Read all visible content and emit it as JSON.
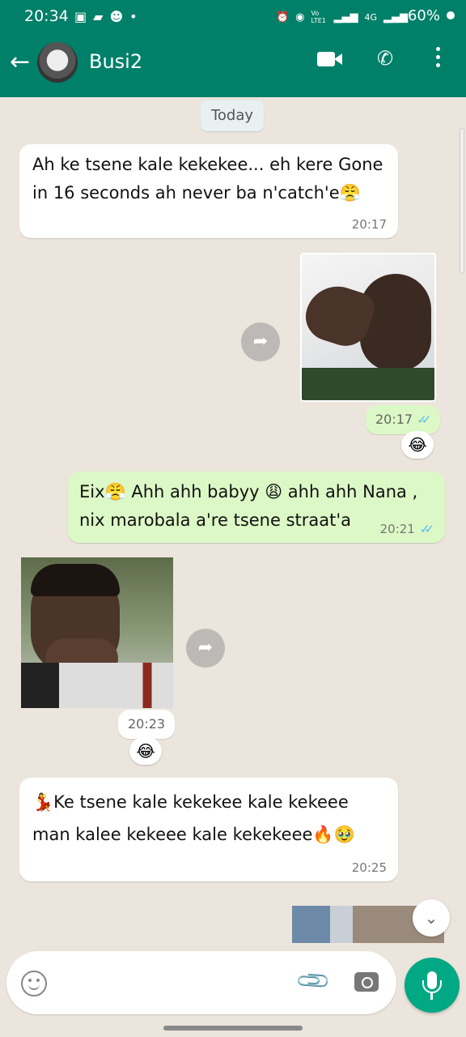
{
  "status_bar": {
    "time": "20:34",
    "left_icons": [
      "gallery-icon",
      "message-icon",
      "contact-icon",
      "dot"
    ],
    "right_icons": [
      "alarm-icon",
      "hotspot-icon",
      "volte-icon",
      "signal-icon",
      "4g-icon",
      "signal-icon"
    ],
    "network_label": "4G",
    "volte_label": "Vo LTE1",
    "battery": "60%"
  },
  "header": {
    "contact_name": "Busi2",
    "icons": [
      "back-arrow-icon",
      "video-call-icon",
      "voice-call-icon",
      "more-options-icon"
    ]
  },
  "chat": {
    "date_label": "Today",
    "messages": [
      {
        "direction": "in",
        "text_line1": "Ah ke tsene kale kekekee... eh kere Gone",
        "text_line2": "in 16 seconds ah never ba n'catch'e😤",
        "time": "20:17"
      },
      {
        "direction": "out",
        "type": "image",
        "image_desc": "person pointing",
        "time": "20:17",
        "ticks": "✓✓",
        "reaction": "😂"
      },
      {
        "direction": "out",
        "text_line1": "Eix😤 Ahh ahh babyy 😩 ahh ahh Nana ,",
        "text_line2": "nix marobala a're tsene straat'a",
        "time": "20:21",
        "ticks": "✓✓"
      },
      {
        "direction": "in",
        "type": "image",
        "image_desc": "person laughing",
        "time": "20:23",
        "reaction": "😂"
      },
      {
        "direction": "in",
        "text_line1": "💃Ke tsene kale kekekee kale kekeee",
        "text_line2": "man kalee kekeee kale kekekeee🔥🥹",
        "time": "20:25"
      },
      {
        "direction": "out",
        "type": "image",
        "partial": true
      }
    ]
  },
  "input": {
    "placeholder": "",
    "emoji_icon": "emoji-icon",
    "attach_icon": "attach-icon",
    "camera_icon": "camera-icon",
    "mic_icon": "mic-icon"
  },
  "colors": {
    "header": "#008069",
    "chat_bg": "#ECE5DD",
    "outgoing": "#DCF8C6",
    "incoming": "#FFFFFF",
    "read_ticks": "#53BDEB",
    "mic_button": "#00A884"
  }
}
